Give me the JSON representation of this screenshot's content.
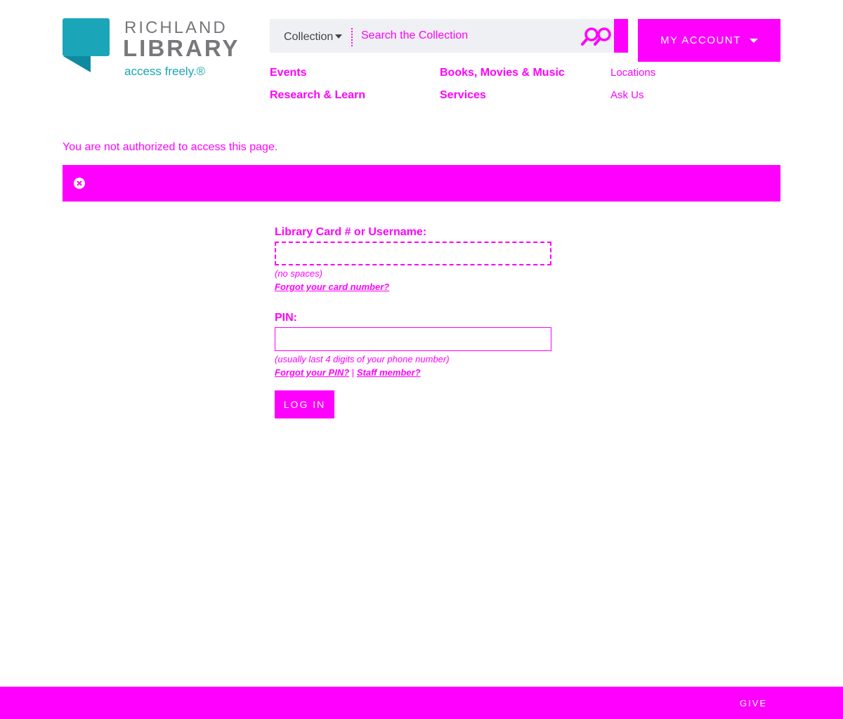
{
  "logo": {
    "line1": "RICHLAND",
    "line2": "LIBRARY",
    "tagline": "access freely.®",
    "brand_color": "#1ba5b8",
    "text_color": "#77787b"
  },
  "search": {
    "scope_label": "Collection",
    "placeholder": "Search the Collection",
    "icon": "search-icon"
  },
  "account": {
    "label": "MY ACCOUNT",
    "icon": "chevron-down-icon"
  },
  "nav": {
    "events": "Events",
    "research": "Research & Learn",
    "books": "Books, Movies & Music",
    "services": "Services",
    "locations": "Locations",
    "ask": "Ask Us"
  },
  "message": {
    "unauthorized": "You are not authorized to access this page.",
    "close_icon": "close-icon"
  },
  "login_form": {
    "card_label": "Library Card # or Username:",
    "card_value": "",
    "card_hint": "(no spaces)",
    "forgot_card": "Forgot your card number?",
    "pin_label": "PIN:",
    "pin_value": "",
    "pin_hint": "(usually last 4 digits of your phone number)",
    "forgot_pin": "Forgot your PIN?",
    "separator": "|",
    "staff": "Staff member?",
    "submit": "LOG IN"
  },
  "footer": {
    "give": "GIVE"
  },
  "colors": {
    "accent": "#ff00ff",
    "search_bg": "#eef0f3"
  }
}
